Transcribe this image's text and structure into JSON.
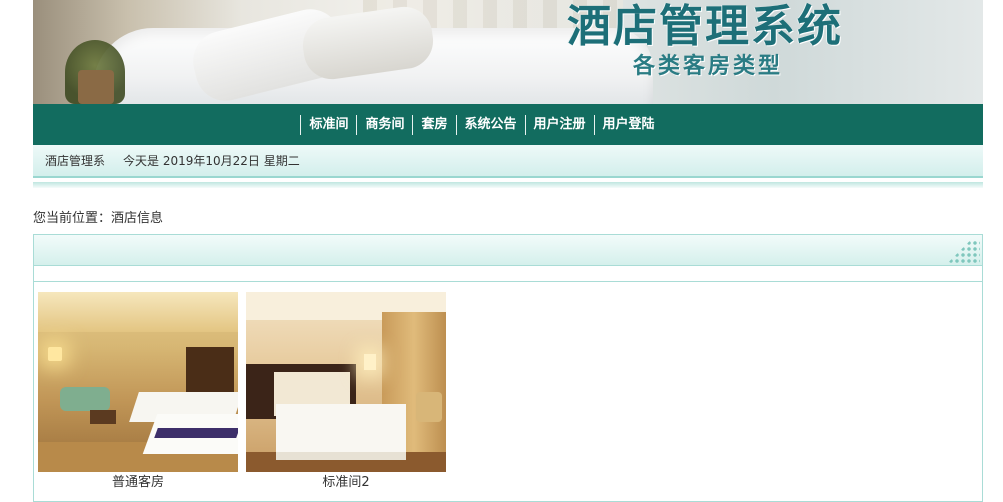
{
  "banner": {
    "title": "酒店管理系统",
    "subtitle": "各类客房类型"
  },
  "nav": {
    "items": [
      {
        "label": "标准间"
      },
      {
        "label": "商务间"
      },
      {
        "label": "套房"
      },
      {
        "label": "系统公告"
      },
      {
        "label": "用户注册"
      },
      {
        "label": "用户登陆"
      }
    ]
  },
  "datebar": {
    "site": "酒店管理系",
    "date_text": "今天是 2019年10月22日 星期二"
  },
  "breadcrumb": {
    "text": "您当前位置：酒店信息"
  },
  "colors": {
    "nav_bg": "#126c5f",
    "accent": "#1d6f78",
    "panel_border": "#a9dcd6"
  },
  "rooms": [
    {
      "name": "普通客房",
      "image": "hotel-room-photo"
    },
    {
      "name": "标准间2",
      "image": "hotel-room-photo"
    }
  ]
}
